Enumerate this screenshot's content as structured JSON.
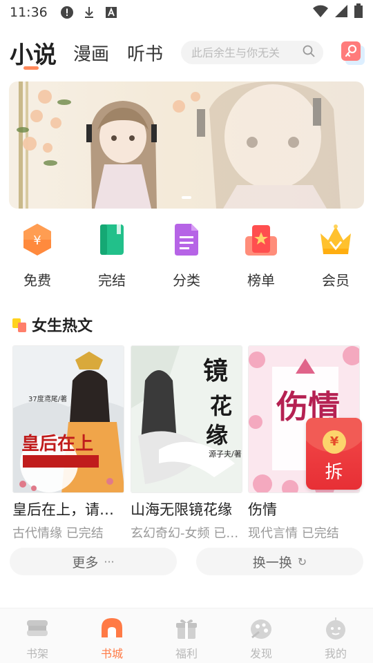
{
  "status_bar": {
    "time": "11:36"
  },
  "header": {
    "tabs": [
      {
        "label": "小说",
        "active": true
      },
      {
        "label": "漫画",
        "active": false
      },
      {
        "label": "听书",
        "active": false
      }
    ],
    "search": {
      "placeholder": "此后余生与你无关"
    }
  },
  "categories": [
    {
      "label": "免费",
      "icon": "free-coin-icon"
    },
    {
      "label": "完结",
      "icon": "completed-book-icon"
    },
    {
      "label": "分类",
      "icon": "category-document-icon"
    },
    {
      "label": "榜单",
      "icon": "ranking-icon"
    },
    {
      "label": "会员",
      "icon": "vip-crown-icon"
    }
  ],
  "section": {
    "title": "女生热文"
  },
  "books": [
    {
      "title": "皇后在上，请受为夫一拜",
      "meta": "古代情缘 已完结",
      "cover_text": "皇后在上",
      "cover_author": "37度鸢尾/著"
    },
    {
      "title": "山海无限镜花缘",
      "meta": "玄幻奇幻-女频 已完结",
      "cover_text": "镜花缘",
      "cover_author": "源子夫/著"
    },
    {
      "title": "伤情",
      "meta": "现代言情 已完结",
      "cover_text": "伤情"
    }
  ],
  "red_packet": {
    "symbol": "¥",
    "label": "拆"
  },
  "buttons": {
    "more": "更多",
    "more_suffix": "···",
    "refresh": "换一换",
    "refresh_suffix": "↻"
  },
  "bottom_nav": [
    {
      "label": "书架",
      "active": false
    },
    {
      "label": "书城",
      "active": true
    },
    {
      "label": "福利",
      "active": false
    },
    {
      "label": "发现",
      "active": false
    },
    {
      "label": "我的",
      "active": false
    }
  ],
  "colors": {
    "accent": "#ff7a45",
    "inactive": "#b8b8b8"
  }
}
